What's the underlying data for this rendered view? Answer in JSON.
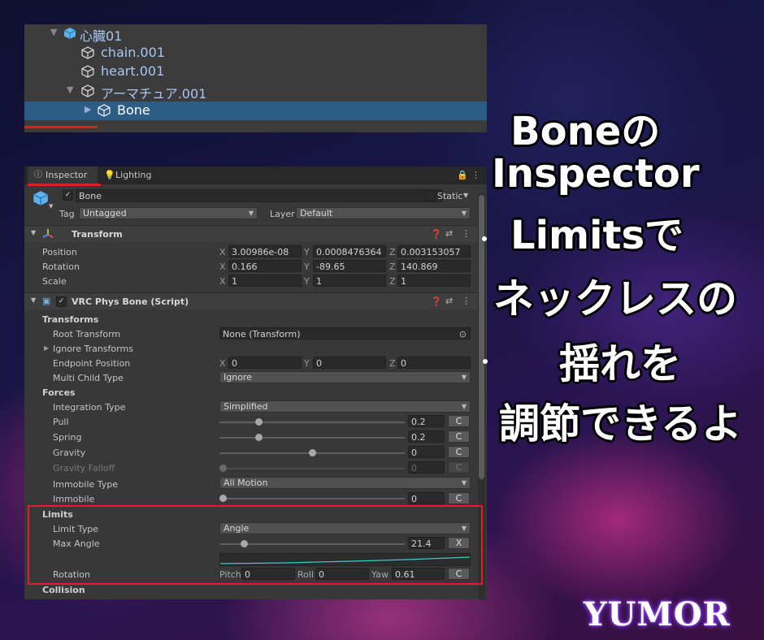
{
  "hierarchy": {
    "items": [
      {
        "label": "心臓01"
      },
      {
        "label": "chain.001"
      },
      {
        "label": "heart.001"
      },
      {
        "label": "アーマチュア.001"
      },
      {
        "label": "Bone"
      }
    ]
  },
  "inspector": {
    "tabs": {
      "inspector": "Inspector",
      "lighting": "Lighting"
    },
    "object": {
      "name": "Bone",
      "static_label": "Static",
      "tag_label": "Tag",
      "tag_value": "Untagged",
      "layer_label": "Layer",
      "layer_value": "Default"
    },
    "transform": {
      "title": "Transform",
      "position_label": "Position",
      "rotation_label": "Rotation",
      "scale_label": "Scale",
      "position": {
        "x": "3.00986e-08",
        "y": "0.0008476364",
        "z": "0.003153057"
      },
      "rotation": {
        "x": "0.166",
        "y": "-89.65",
        "z": "140.869"
      },
      "scale": {
        "x": "1",
        "y": "1",
        "z": "1"
      }
    },
    "physbone": {
      "title": "VRC Phys Bone (Script)",
      "transforms_section": "Transforms",
      "root_transform_label": "Root Transform",
      "root_transform_value": "None (Transform)",
      "ignore_transforms_label": "Ignore Transforms",
      "endpoint_label": "Endpoint Position",
      "endpoint": {
        "x": "0",
        "y": "0",
        "z": "0"
      },
      "multichild_label": "Multi Child Type",
      "multichild_value": "Ignore",
      "forces_section": "Forces",
      "integration_label": "Integration Type",
      "integration_value": "Simplified",
      "pull_label": "Pull",
      "pull_value": "0.2",
      "pull_level": 0.2,
      "spring_label": "Spring",
      "spring_value": "0.2",
      "spring_level": 0.2,
      "gravity_label": "Gravity",
      "gravity_value": "0",
      "gravity_level": 0.5,
      "gravity_falloff_label": "Gravity Falloff",
      "gravity_falloff_value": "0",
      "gravity_falloff_level": 0,
      "immobile_type_label": "Immobile Type",
      "immobile_type_value": "All Motion",
      "immobile_label": "Immobile",
      "immobile_value": "0",
      "immobile_level": 0,
      "limits_section": "Limits",
      "limit_type_label": "Limit Type",
      "limit_type_value": "Angle",
      "max_angle_label": "Max Angle",
      "max_angle_value": "21.4",
      "max_angle_level": 0.12,
      "rotation_label": "Rotation",
      "pitch_label": "Pitch",
      "pitch_value": "0",
      "roll_label": "Roll",
      "roll_value": "0",
      "yaw_label": "Yaw",
      "yaw_value": "0.61",
      "collision_section": "Collision",
      "c_button": "C",
      "x_button": "X"
    }
  },
  "overlay": {
    "lines": [
      "Boneの",
      "Inspector",
      "Limitsで",
      "ネックレスの",
      "揺れを",
      "調節できるよ"
    ],
    "brand": "YUMOR"
  }
}
